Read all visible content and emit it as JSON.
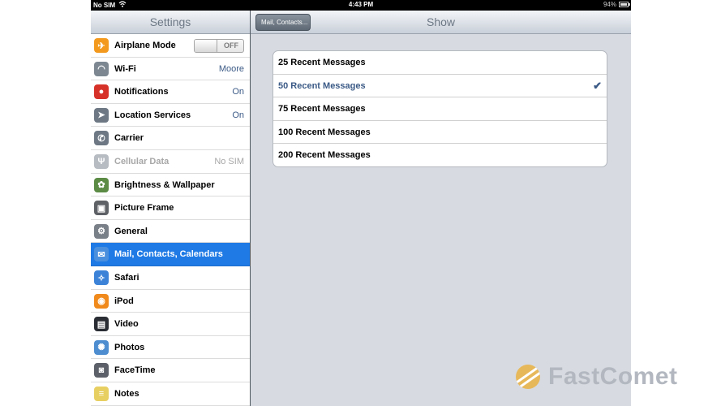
{
  "status_bar": {
    "carrier": "No SIM",
    "time": "4:43 PM",
    "battery": "94%"
  },
  "settings_nav": {
    "title": "Settings"
  },
  "settings_items": [
    {
      "label": "Airplane Mode",
      "icon": "airplane-icon",
      "icon_color": "#f39a1e",
      "toggle": "OFF"
    },
    {
      "label": "Wi-Fi",
      "icon": "wifi-icon",
      "icon_color": "#7c8791",
      "value": "Moore"
    },
    {
      "label": "Notifications",
      "icon": "notifications-icon",
      "icon_color": "#d7322a",
      "value": "On"
    },
    {
      "label": "Location Services",
      "icon": "location-icon",
      "icon_color": "#6d7884",
      "value": "On"
    },
    {
      "label": "Carrier",
      "icon": "phone-icon",
      "icon_color": "#6d7884"
    },
    {
      "label": "Cellular Data",
      "icon": "antenna-icon",
      "icon_color": "#b7bcc2",
      "value": "No SIM",
      "disabled": true
    },
    {
      "label": "Brightness & Wallpaper",
      "icon": "flower-icon",
      "icon_color": "#5b8b45"
    },
    {
      "label": "Picture Frame",
      "icon": "picture-frame-icon",
      "icon_color": "#5e6166"
    },
    {
      "label": "General",
      "icon": "gear-icon",
      "icon_color": "#7a8088"
    },
    {
      "label": "Mail, Contacts, Calendars",
      "icon": "mail-icon",
      "icon_color": "#4a8fde",
      "selected": true
    },
    {
      "label": "Safari",
      "icon": "compass-icon",
      "icon_color": "#3c83d8"
    },
    {
      "label": "iPod",
      "icon": "ipod-icon",
      "icon_color": "#f08a1c"
    },
    {
      "label": "Video",
      "icon": "clapper-icon",
      "icon_color": "#2a2d33"
    },
    {
      "label": "Photos",
      "icon": "sunflower-icon",
      "icon_color": "#4d8dd0"
    },
    {
      "label": "FaceTime",
      "icon": "camera-icon",
      "icon_color": "#5c6068"
    },
    {
      "label": "Notes",
      "icon": "notes-icon",
      "icon_color": "#e8cf62"
    }
  ],
  "detail_nav": {
    "back_label": "Mail, Contacts...",
    "title": "Show"
  },
  "show_options": [
    {
      "label": "25 Recent Messages",
      "checked": false
    },
    {
      "label": "50 Recent Messages",
      "checked": true
    },
    {
      "label": "75 Recent Messages",
      "checked": false
    },
    {
      "label": "100 Recent Messages",
      "checked": false
    },
    {
      "label": "200 Recent Messages",
      "checked": false
    }
  ],
  "watermark": {
    "text": "FastComet"
  }
}
